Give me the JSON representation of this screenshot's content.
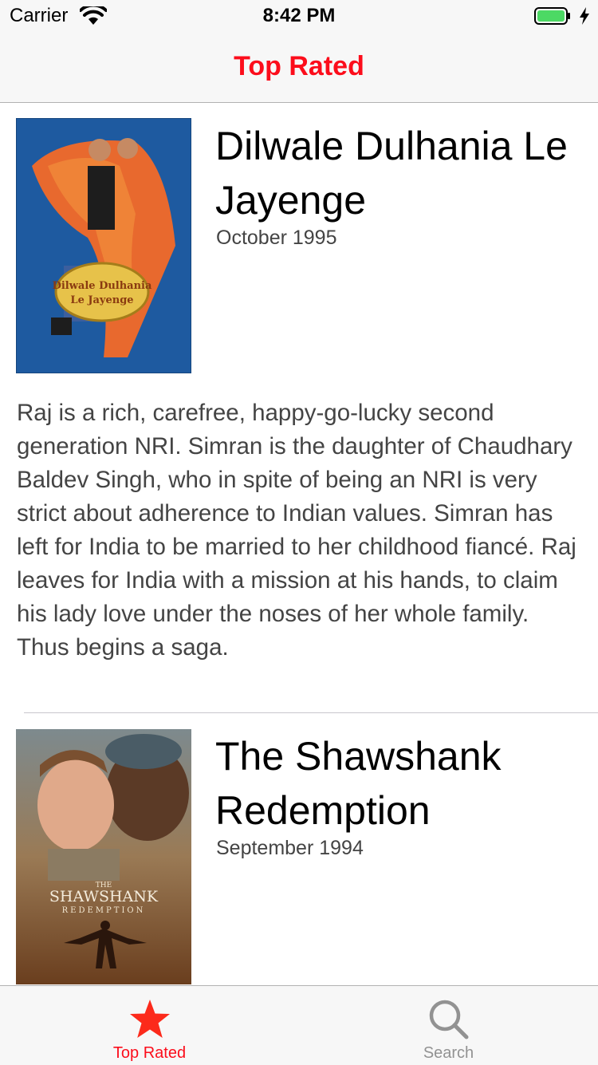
{
  "status_bar": {
    "carrier": "Carrier",
    "time": "8:42 PM"
  },
  "nav": {
    "title": "Top Rated"
  },
  "movies": [
    {
      "title": "Dilwale Dulhania Le Jayenge",
      "date": "October 1995",
      "overview": "Raj is a rich, carefree, happy-go-lucky second generation NRI. Simran is the daughter of Chaudhary Baldev Singh, who in spite of being an NRI is very strict about adherence to Indian values. Simran has left for India to be married to her childhood fiancé. Raj leaves for India with a mission at his hands, to claim his lady love under the noses of her whole family. Thus begins a saga.",
      "poster_text_1": "Dilwale Dulhania",
      "poster_text_2": "Le Jayenge"
    },
    {
      "title": "The Shawshank Redemption",
      "date": "September 1994",
      "poster_text_1": "THE",
      "poster_text_2": "SHAWSHANK",
      "poster_text_3": "REDEMPTION"
    }
  ],
  "tab_bar": {
    "tabs": [
      {
        "label": "Top Rated",
        "icon": "star-icon",
        "selected": true
      },
      {
        "label": "Search",
        "icon": "search-icon",
        "selected": false
      }
    ]
  },
  "colors": {
    "accent": "#fc0d1b",
    "inactive": "#929292",
    "battery": "#4cd964"
  }
}
